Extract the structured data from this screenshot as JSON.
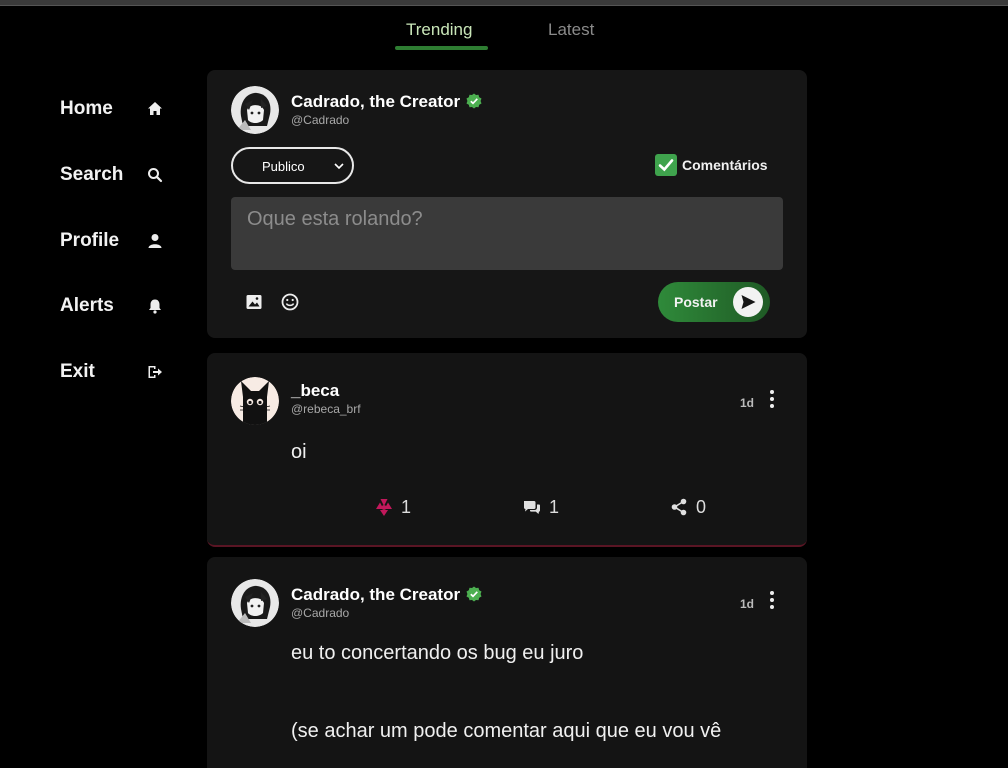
{
  "tabs": [
    {
      "label": "Trending",
      "active": true
    },
    {
      "label": "Latest",
      "active": false
    }
  ],
  "sidebar": {
    "items": [
      {
        "label": "Home",
        "icon": "home-icon"
      },
      {
        "label": "Search",
        "icon": "search-icon"
      },
      {
        "label": "Profile",
        "icon": "person-icon"
      },
      {
        "label": "Alerts",
        "icon": "bell-icon"
      },
      {
        "label": "Exit",
        "icon": "logout-icon"
      }
    ]
  },
  "composer": {
    "user_name": "Cadrado, the Creator",
    "user_handle": "@Cadrado",
    "visibility_selected": "Publico",
    "comments_label": "Comentários",
    "comments_enabled": true,
    "placeholder": "Oque esta rolando?",
    "post_label": "Postar"
  },
  "posts": [
    {
      "user_name": "_beca",
      "user_handle": "@rebeca_brf",
      "time": "1d",
      "content": "oi",
      "likes": "1",
      "comments": "1",
      "shares": "0"
    },
    {
      "user_name": "Cadrado, the Creator",
      "user_handle": "@Cadrado",
      "verified": true,
      "time": "1d",
      "content_line1": "eu to concertando os bug eu juro",
      "content_line2": "(se achar um pode comentar aqui que eu vou vê"
    }
  ],
  "colors": {
    "accent": "#2e7d32",
    "verified": "#4caf50",
    "like": "#c2185b",
    "background": "#000000",
    "card": "#161616"
  }
}
